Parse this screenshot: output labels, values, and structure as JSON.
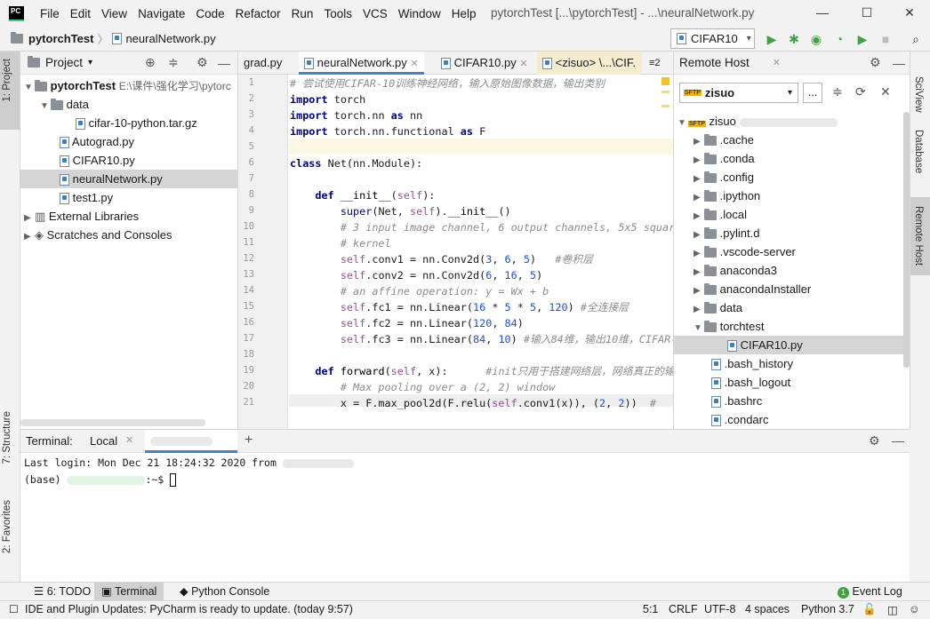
{
  "menubar": {
    "logo": "PC",
    "items": [
      "File",
      "Edit",
      "View",
      "Navigate",
      "Code",
      "Refactor",
      "Run",
      "Tools",
      "VCS",
      "Window",
      "Help"
    ],
    "title": "pytorchTest [...\\pytorchTest] - ...\\neuralNetwork.py"
  },
  "navbar": {
    "project": "pytorchTest",
    "file": "neuralNetwork.py",
    "run_config": "CIFAR10"
  },
  "left_strip": {
    "project_tab": "1: Project",
    "structure_tab": "7: Structure",
    "favorites_tab": "2: Favorites"
  },
  "right_strip": {
    "sciview": "SciView",
    "database": "Database",
    "remote_host": "Remote Host"
  },
  "project_panel": {
    "header": "Project",
    "root_name": "pytorchTest",
    "root_path": "E:\\课件\\强化学习\\pytorc",
    "items": [
      "data",
      "cifar-10-python.tar.gz",
      "Autograd.py",
      "CIFAR10.py",
      "neuralNetwork.py",
      "test1.py",
      "External Libraries",
      "Scratches and Consoles"
    ]
  },
  "editor": {
    "tabs": [
      "grad.py",
      "neuralNetwork.py",
      "CIFAR10.py",
      "<zisuo> \\...\\CIF."
    ],
    "tab_count": "≡2",
    "line_numbers": [
      "1",
      "2",
      "3",
      "4",
      "5",
      "6",
      "7",
      "8",
      "9",
      "10",
      "11",
      "12",
      "13",
      "14",
      "15",
      "16",
      "17",
      "18",
      "19",
      "20",
      "21"
    ]
  },
  "remote_panel": {
    "header": "Remote Host",
    "server": "zisuo",
    "root": "zisuo",
    "sftp": "SFTP",
    "items": [
      ".cache",
      ".conda",
      ".config",
      ".ipython",
      ".local",
      ".pylint.d",
      ".vscode-server",
      "anaconda3",
      "anacondaInstaller",
      "data",
      "torchtest",
      "CIFAR10.py",
      ".bash_history",
      ".bash_logout",
      ".bashrc",
      ".condarc"
    ]
  },
  "terminal": {
    "label": "Terminal:",
    "tab_local": "Local",
    "line1": "Last login: Mon Dec 21 18:24:32 2020 from",
    "prompt_prefix": "(base)",
    "prompt_suffix": ":~$"
  },
  "toolwindows": {
    "todo": "6: TODO",
    "terminal": "Terminal",
    "python_console": "Python Console",
    "event_log": "Event Log",
    "event_count": "1"
  },
  "statusbar": {
    "message": "IDE and Plugin Updates: PyCharm is ready to update. (today 9:57)",
    "position": "5:1",
    "line_sep": "CRLF",
    "encoding": "UTF-8",
    "indent": "4 spaces",
    "interpreter": "Python 3.7"
  }
}
